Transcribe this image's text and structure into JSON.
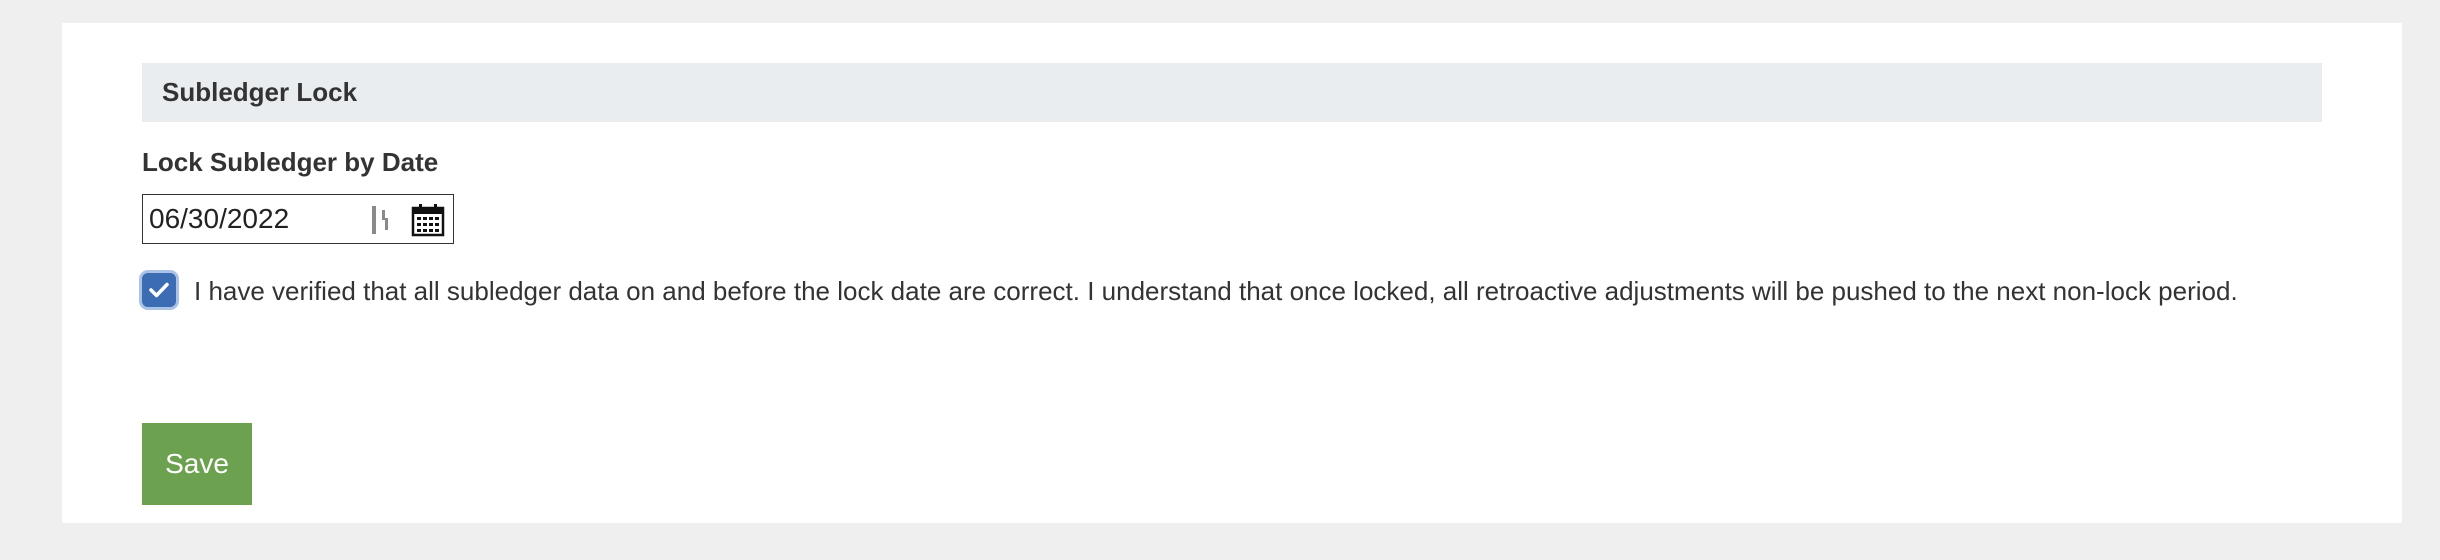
{
  "section": {
    "title": "Subledger Lock"
  },
  "lock_date": {
    "label": "Lock Subledger by Date",
    "value": "06/30/2022",
    "calendar_icon": "calendar-icon",
    "cursor_icon": "text-cursor-icon"
  },
  "confirmation": {
    "checked": true,
    "text": "I have verified that all subledger data on and before the lock date are correct. I understand that once locked, all retroactive adjustments will be pushed to the next non-lock period."
  },
  "actions": {
    "save_label": "Save"
  },
  "colors": {
    "page_background": "#efefef",
    "header_background": "#e9edf0",
    "checkbox": "#3c6cb4",
    "save_button": "#6ca24f"
  }
}
